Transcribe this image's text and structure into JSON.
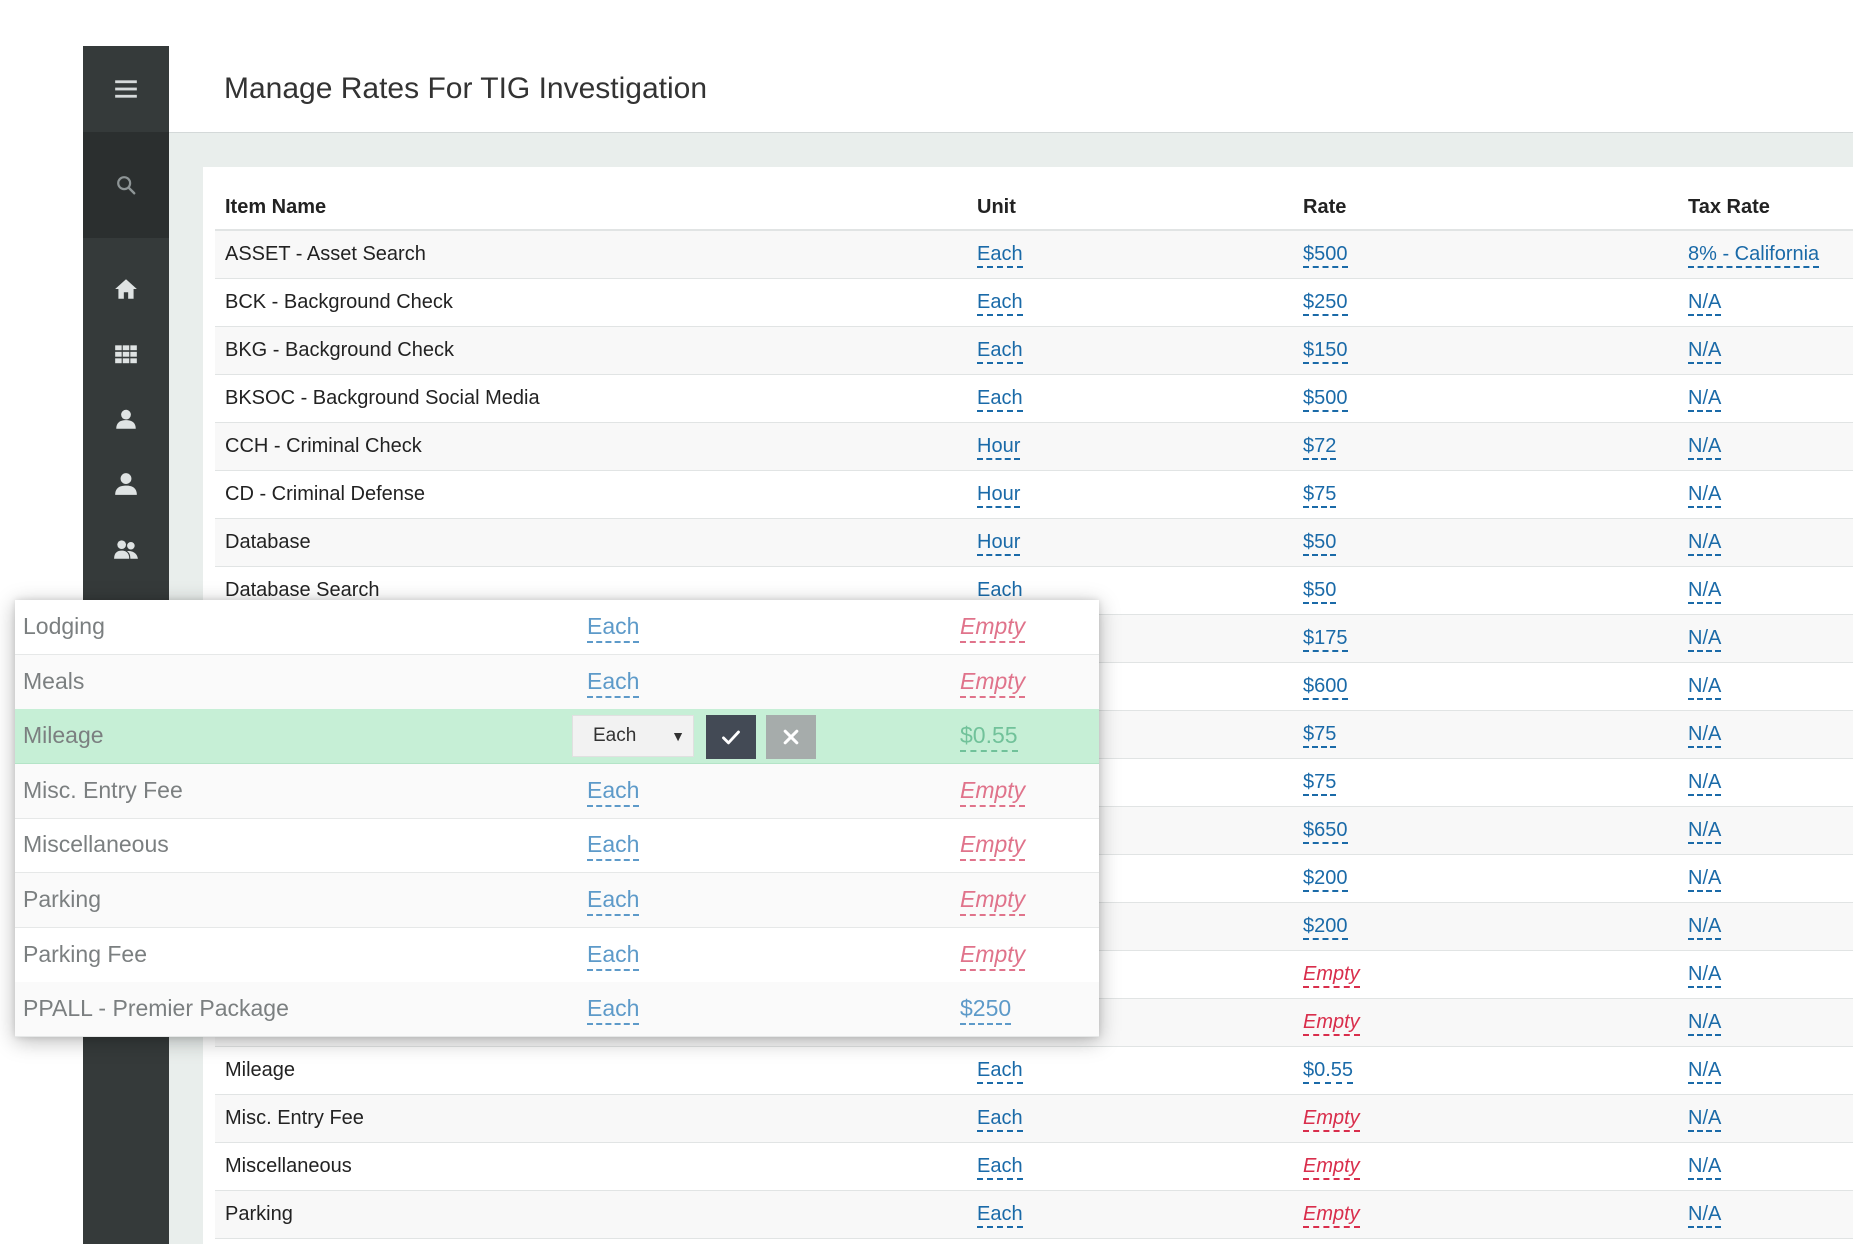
{
  "page": {
    "title": "Manage Rates For TIG Investigation"
  },
  "sidebar": {
    "icons": [
      "menu-icon",
      "search-icon",
      "home-icon",
      "grid-icon",
      "user-icon",
      "user-alt-icon",
      "users-icon",
      "cubes-icon"
    ]
  },
  "table": {
    "headers": {
      "item": "Item Name",
      "unit": "Unit",
      "rate": "Rate",
      "tax": "Tax Rate"
    },
    "rows": [
      {
        "item": "ASSET - Asset Search",
        "unit": "Each",
        "rate": "$500",
        "rate_empty": false,
        "tax": "8% - California"
      },
      {
        "item": "BCK - Background Check",
        "unit": "Each",
        "rate": "$250",
        "rate_empty": false,
        "tax": "N/A"
      },
      {
        "item": "BKG - Background Check",
        "unit": "Each",
        "rate": "$150",
        "rate_empty": false,
        "tax": "N/A"
      },
      {
        "item": "BKSOC - Background Social Media",
        "unit": "Each",
        "rate": "$500",
        "rate_empty": false,
        "tax": "N/A"
      },
      {
        "item": "CCH - Criminal Check",
        "unit": "Hour",
        "rate": "$72",
        "rate_empty": false,
        "tax": "N/A"
      },
      {
        "item": "CD - Criminal Defense",
        "unit": "Hour",
        "rate": "$75",
        "rate_empty": false,
        "tax": "N/A"
      },
      {
        "item": "Database",
        "unit": "Hour",
        "rate": "$50",
        "rate_empty": false,
        "tax": "N/A"
      },
      {
        "item": "Database Search",
        "unit": "Each",
        "rate": "$50",
        "rate_empty": false,
        "tax": "N/A"
      },
      {
        "item": "",
        "unit": "",
        "rate": "$175",
        "rate_empty": false,
        "tax": "N/A"
      },
      {
        "item": "",
        "unit": "",
        "rate": "$600",
        "rate_empty": false,
        "tax": "N/A"
      },
      {
        "item": "",
        "unit": "",
        "rate": "$75",
        "rate_empty": false,
        "tax": "N/A"
      },
      {
        "item": "",
        "unit": "",
        "rate": "$75",
        "rate_empty": false,
        "tax": "N/A"
      },
      {
        "item": "",
        "unit": "",
        "rate": "$650",
        "rate_empty": false,
        "tax": "N/A"
      },
      {
        "item": "",
        "unit": "",
        "rate": "$200",
        "rate_empty": false,
        "tax": "N/A"
      },
      {
        "item": "",
        "unit": "",
        "rate": "$200",
        "rate_empty": false,
        "tax": "N/A"
      },
      {
        "item": "",
        "unit": "",
        "rate": "Empty",
        "rate_empty": true,
        "tax": "N/A"
      },
      {
        "item": "",
        "unit": "",
        "rate": "Empty",
        "rate_empty": true,
        "tax": "N/A"
      },
      {
        "item": "Mileage",
        "unit": "Each",
        "rate": "$0.55",
        "rate_empty": false,
        "tax": "N/A"
      },
      {
        "item": "Misc. Entry Fee",
        "unit": "Each",
        "rate": "Empty",
        "rate_empty": true,
        "tax": "N/A"
      },
      {
        "item": "Miscellaneous",
        "unit": "Each",
        "rate": "Empty",
        "rate_empty": true,
        "tax": "N/A"
      },
      {
        "item": "Parking",
        "unit": "Each",
        "rate": "Empty",
        "rate_empty": true,
        "tax": "N/A"
      }
    ]
  },
  "popup": {
    "rows": [
      {
        "item": "Lodging",
        "unit": "Each",
        "rate": "Empty",
        "state": "empty"
      },
      {
        "item": "Meals",
        "unit": "Each",
        "rate": "Empty",
        "state": "empty"
      },
      {
        "item": "Mileage",
        "unit": "Each",
        "rate": "$0.55",
        "state": "editing"
      },
      {
        "item": "Misc. Entry Fee",
        "unit": "Each",
        "rate": "Empty",
        "state": "empty"
      },
      {
        "item": "Miscellaneous",
        "unit": "Each",
        "rate": "Empty",
        "state": "empty"
      },
      {
        "item": "Parking",
        "unit": "Each",
        "rate": "Empty",
        "state": "empty"
      },
      {
        "item": "Parking Fee",
        "unit": "Each",
        "rate": "Empty",
        "state": "empty"
      },
      {
        "item": "PPALL - Premier Package",
        "unit": "Each",
        "rate": "$250",
        "state": "value"
      }
    ],
    "editor": {
      "unit_selected": "Each",
      "confirm_icon": "check-icon",
      "cancel_icon": "close-icon"
    }
  },
  "colors": {
    "sidebar": "#353a3a",
    "link": "#1a6aa8",
    "empty": "#d92e4c",
    "editing_row": "#c6efd6",
    "confirm_button": "#434a55",
    "cancel_button": "#a6acab"
  }
}
